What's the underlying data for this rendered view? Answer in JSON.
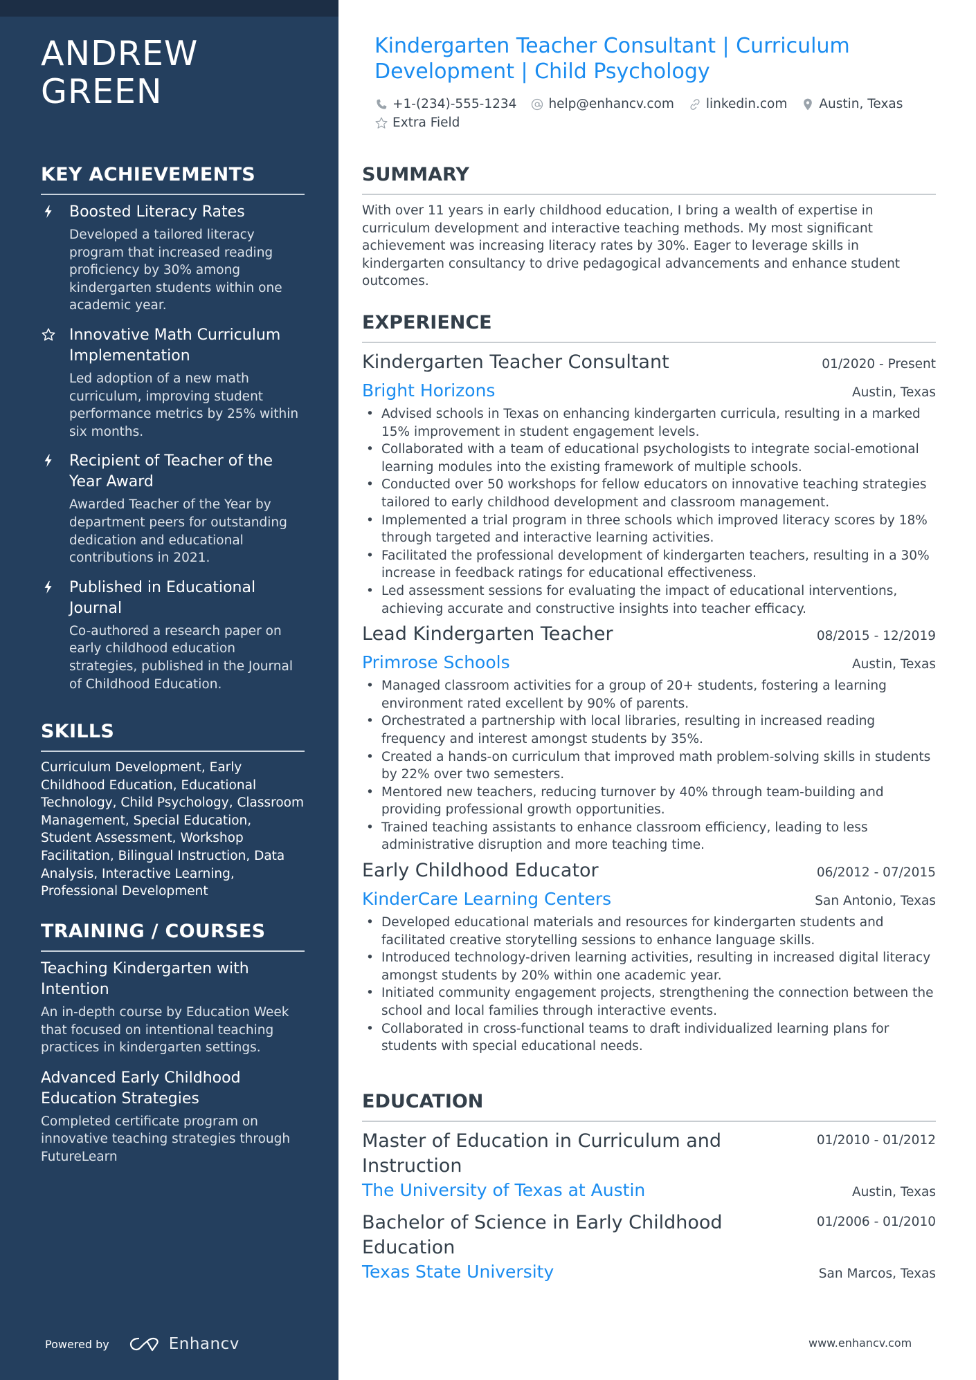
{
  "sidebar": {
    "name_line1": "ANDREW",
    "name_line2": "GREEN",
    "achievements_heading": "KEY ACHIEVEMENTS",
    "achievements": [
      {
        "icon": "lightning-icon",
        "title": "Boosted Literacy Rates",
        "description": "Developed a tailored literacy program that increased reading proficiency by 30% among kindergarten students within one academic year."
      },
      {
        "icon": "star-icon",
        "title": "Innovative Math Curriculum Implementation",
        "description": "Led adoption of a new math curriculum, improving student performance metrics by 25% within six months."
      },
      {
        "icon": "lightning-icon",
        "title": "Recipient of Teacher of the Year Award",
        "description": "Awarded Teacher of the Year by department peers for outstanding dedication and educational contributions in 2021."
      },
      {
        "icon": "lightning-icon",
        "title": "Published in Educational Journal",
        "description": "Co-authored a research paper on early childhood education strategies, published in the Journal of Childhood Education."
      }
    ],
    "skills_heading": "SKILLS",
    "skills_text": "Curriculum Development, Early Childhood Education, Educational Technology, Child Psychology, Classroom Management, Special Education, Student Assessment, Workshop Facilitation, Bilingual Instruction, Data Analysis, Interactive Learning, Professional Development",
    "courses_heading": "TRAINING / COURSES",
    "courses": [
      {
        "title": "Teaching Kindergarten with Intention",
        "description": "An in-depth course by Education Week that focused on intentional teaching practices in kindergarten settings."
      },
      {
        "title": "Advanced Early Childhood Education Strategies",
        "description": "Completed certificate program on innovative teaching strategies through FutureLearn"
      }
    ],
    "powered_by": "Powered by",
    "brand_name": "Enhancv"
  },
  "header": {
    "headline": "Kindergarten Teacher Consultant | Curriculum Development | Child Psychology",
    "contacts": {
      "phone": "+1-(234)-555-1234",
      "email": "help@enhancv.com",
      "link": "linkedin.com",
      "location": "Austin, Texas",
      "extra": "Extra Field"
    }
  },
  "summary": {
    "heading": "SUMMARY",
    "text": "With over 11 years in early childhood education, I bring a wealth of expertise in curriculum development and interactive teaching methods. My most significant achievement was increasing literacy rates by 30%. Eager to leverage skills in kindergarten consultancy to drive pedagogical advancements and enhance student outcomes."
  },
  "experience": {
    "heading": "EXPERIENCE",
    "jobs": [
      {
        "title": "Kindergarten Teacher Consultant",
        "dates": "01/2020 - Present",
        "company": "Bright Horizons",
        "location": "Austin, Texas",
        "bullets": [
          "Advised schools in Texas on enhancing kindergarten curricula, resulting in a marked 15% improvement in student engagement levels.",
          "Collaborated with a team of educational psychologists to integrate social-emotional learning modules into the existing framework of multiple schools.",
          "Conducted over 50 workshops for fellow educators on innovative teaching strategies tailored to early childhood development and classroom management.",
          "Implemented a trial program in three schools which improved literacy scores by 18% through targeted and interactive learning activities.",
          "Facilitated the professional development of kindergarten teachers, resulting in a 30% increase in feedback ratings for educational effectiveness.",
          "Led assessment sessions for evaluating the impact of educational interventions, achieving accurate and constructive insights into teacher efficacy."
        ]
      },
      {
        "title": "Lead Kindergarten Teacher",
        "dates": "08/2015 - 12/2019",
        "company": "Primrose Schools",
        "location": "Austin, Texas",
        "bullets": [
          "Managed classroom activities for a group of 20+ students, fostering a learning environment rated excellent by 90% of parents.",
          "Orchestrated a partnership with local libraries, resulting in increased reading frequency and interest amongst students by 35%.",
          "Created a hands-on curriculum that improved math problem-solving skills in students by 22% over two semesters.",
          "Mentored new teachers, reducing turnover by 40% through team-building and providing professional growth opportunities.",
          "Trained teaching assistants to enhance classroom efficiency, leading to less administrative disruption and more teaching time."
        ]
      },
      {
        "title": "Early Childhood Educator",
        "dates": "06/2012 - 07/2015",
        "company": "KinderCare Learning Centers",
        "location": "San Antonio, Texas",
        "bullets": [
          "Developed educational materials and resources for kindergarten students and facilitated creative storytelling sessions to enhance language skills.",
          "Introduced technology-driven learning activities, resulting in increased digital literacy amongst students by 20% within one academic year.",
          "Initiated community engagement projects, strengthening the connection between the school and local families through interactive events.",
          "Collaborated in cross-functional teams to draft individualized learning plans for students with special educational needs."
        ]
      }
    ]
  },
  "education": {
    "heading": "EDUCATION",
    "items": [
      {
        "degree": "Master of Education in Curriculum and Instruction",
        "dates": "01/2010 - 01/2012",
        "school": "The University of Texas at Austin",
        "location": "Austin, Texas"
      },
      {
        "degree": "Bachelor of Science in Early Childhood Education",
        "dates": "01/2006 - 01/2010",
        "school": "Texas State University",
        "location": "San Marcos, Texas"
      }
    ]
  },
  "footer": {
    "url": "www.enhancv.com"
  },
  "colors": {
    "sidebar_bg": "#243f5e",
    "accent": "#1a8cf0",
    "text": "#3b4550"
  }
}
